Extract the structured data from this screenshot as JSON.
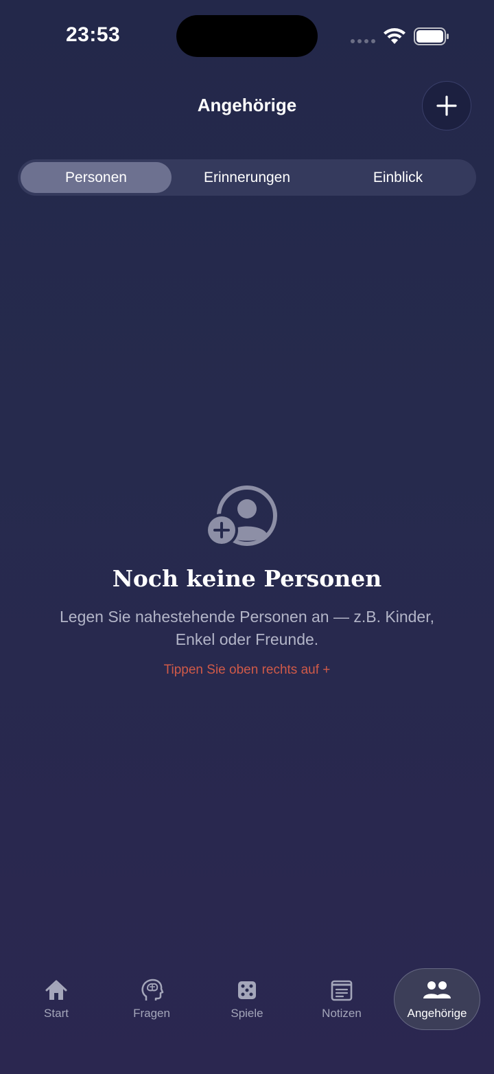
{
  "status_bar": {
    "time": "23:53"
  },
  "header": {
    "title": "Angehörige",
    "add_button_icon": "plus-icon"
  },
  "segments": [
    {
      "label": "Personen",
      "active": true
    },
    {
      "label": "Erinnerungen",
      "active": false
    },
    {
      "label": "Einblick",
      "active": false
    }
  ],
  "empty_state": {
    "icon": "add-person-icon",
    "title": "Noch keine Personen",
    "description": "Legen Sie nahestehende Personen an — z.B. Kinder, Enkel oder Freunde.",
    "hint": "Tippen Sie oben rechts auf +"
  },
  "tabbar": {
    "items": [
      {
        "label": "Start",
        "icon": "home-icon",
        "active": false
      },
      {
        "label": "Fragen",
        "icon": "brain-head-icon",
        "active": false
      },
      {
        "label": "Spiele",
        "icon": "dice-icon",
        "active": false
      },
      {
        "label": "Notizen",
        "icon": "notes-icon",
        "active": false
      },
      {
        "label": "Angehörige",
        "icon": "people-icon",
        "active": true
      }
    ]
  },
  "colors": {
    "background": "#252a4c",
    "segment_active": "#6d7190",
    "hint": "#d05a48",
    "muted_text": "#b3b5c8"
  }
}
